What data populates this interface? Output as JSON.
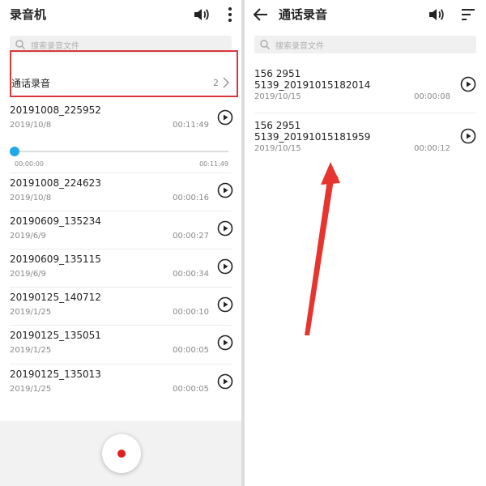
{
  "left": {
    "title": "录音机",
    "search_placeholder": "搜索录音文件",
    "call_folder": {
      "label": "通话录音",
      "count": "2"
    },
    "recordings": [
      {
        "name": "20191008_225952",
        "date": "2019/10/8",
        "duration": "00:11:49"
      },
      {
        "name": "20191008_224623",
        "date": "2019/10/8",
        "duration": "00:00:16"
      },
      {
        "name": "20190609_135234",
        "date": "2019/6/9",
        "duration": "00:00:27"
      },
      {
        "name": "20190609_135115",
        "date": "2019/6/9",
        "duration": "00:00:34"
      },
      {
        "name": "20190125_140712",
        "date": "2019/1/25",
        "duration": "00:00:10"
      },
      {
        "name": "20190125_135051",
        "date": "2019/1/25",
        "duration": "00:00:05"
      },
      {
        "name": "20190125_135013",
        "date": "2019/1/25",
        "duration": "00:00:05"
      }
    ],
    "player": {
      "current": "00:00:00",
      "total": "00:11:49",
      "progress": 0
    }
  },
  "right": {
    "title": "通话录音",
    "search_placeholder": "搜索录音文件",
    "recordings": [
      {
        "line1": "156 2951",
        "line2": "5139_20191015182014",
        "date": "2019/10/15",
        "duration": "00:00:08"
      },
      {
        "line1": "156 2951",
        "line2": "5139_20191015181959",
        "date": "2019/10/15",
        "duration": "00:00:12"
      }
    ]
  },
  "colors": {
    "highlight": "#d9383a",
    "accent": "#1fa9e8",
    "record": "#e02020"
  },
  "icons": [
    "speaker-icon",
    "more-vertical-icon",
    "back-arrow-icon",
    "sort-icon",
    "search-icon",
    "chevron-right-icon",
    "play-icon",
    "record-icon"
  ]
}
